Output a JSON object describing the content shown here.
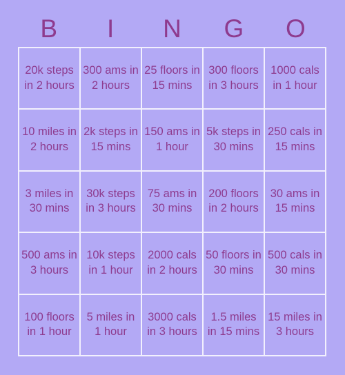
{
  "card": {
    "title": "BINGO",
    "header_letters": [
      "B",
      "I",
      "N",
      "G",
      "O"
    ],
    "colors": {
      "background": "#b3a9f5",
      "cell_background": "#b3a9f5",
      "gridline": "#f2f0fd",
      "text": "#8e3b8e",
      "header_text": "#8e3b8e"
    },
    "grid_size": "5x5",
    "cells": [
      {
        "row": 1,
        "col": 1,
        "column_letter": "B",
        "text": "20k steps in 2 hours"
      },
      {
        "row": 1,
        "col": 2,
        "column_letter": "I",
        "text": "300 ams in 2 hours"
      },
      {
        "row": 1,
        "col": 3,
        "column_letter": "N",
        "text": "25 floors in 15 mins"
      },
      {
        "row": 1,
        "col": 4,
        "column_letter": "G",
        "text": "300 floors in 3 hours"
      },
      {
        "row": 1,
        "col": 5,
        "column_letter": "O",
        "text": "1000 cals in 1 hour"
      },
      {
        "row": 2,
        "col": 1,
        "column_letter": "B",
        "text": "10 miles in 2 hours"
      },
      {
        "row": 2,
        "col": 2,
        "column_letter": "I",
        "text": "2k steps in 15 mins"
      },
      {
        "row": 2,
        "col": 3,
        "column_letter": "N",
        "text": "150 ams in 1 hour"
      },
      {
        "row": 2,
        "col": 4,
        "column_letter": "G",
        "text": "5k steps in 30 mins"
      },
      {
        "row": 2,
        "col": 5,
        "column_letter": "O",
        "text": "250 cals in 15 mins"
      },
      {
        "row": 3,
        "col": 1,
        "column_letter": "B",
        "text": "3 miles in 30 mins"
      },
      {
        "row": 3,
        "col": 2,
        "column_letter": "I",
        "text": "30k steps in 3 hours"
      },
      {
        "row": 3,
        "col": 3,
        "column_letter": "N",
        "text": "75 ams in 30 mins"
      },
      {
        "row": 3,
        "col": 4,
        "column_letter": "G",
        "text": "200 floors in 2 hours"
      },
      {
        "row": 3,
        "col": 5,
        "column_letter": "O",
        "text": "30 ams in 15 mins"
      },
      {
        "row": 4,
        "col": 1,
        "column_letter": "B",
        "text": "500 ams in 3 hours"
      },
      {
        "row": 4,
        "col": 2,
        "column_letter": "I",
        "text": "10k steps in 1 hour"
      },
      {
        "row": 4,
        "col": 3,
        "column_letter": "N",
        "text": "2000 cals in 2 hours"
      },
      {
        "row": 4,
        "col": 4,
        "column_letter": "G",
        "text": "50 floors in 30 mins"
      },
      {
        "row": 4,
        "col": 5,
        "column_letter": "O",
        "text": "500 cals in 30 mins"
      },
      {
        "row": 5,
        "col": 1,
        "column_letter": "B",
        "text": "100 floors in 1 hour"
      },
      {
        "row": 5,
        "col": 2,
        "column_letter": "I",
        "text": "5 miles in 1 hour"
      },
      {
        "row": 5,
        "col": 3,
        "column_letter": "N",
        "text": "3000 cals in 3 hours"
      },
      {
        "row": 5,
        "col": 4,
        "column_letter": "G",
        "text": "1.5 miles in 15 mins"
      },
      {
        "row": 5,
        "col": 5,
        "column_letter": "O",
        "text": "15 miles in 3 hours"
      }
    ]
  }
}
